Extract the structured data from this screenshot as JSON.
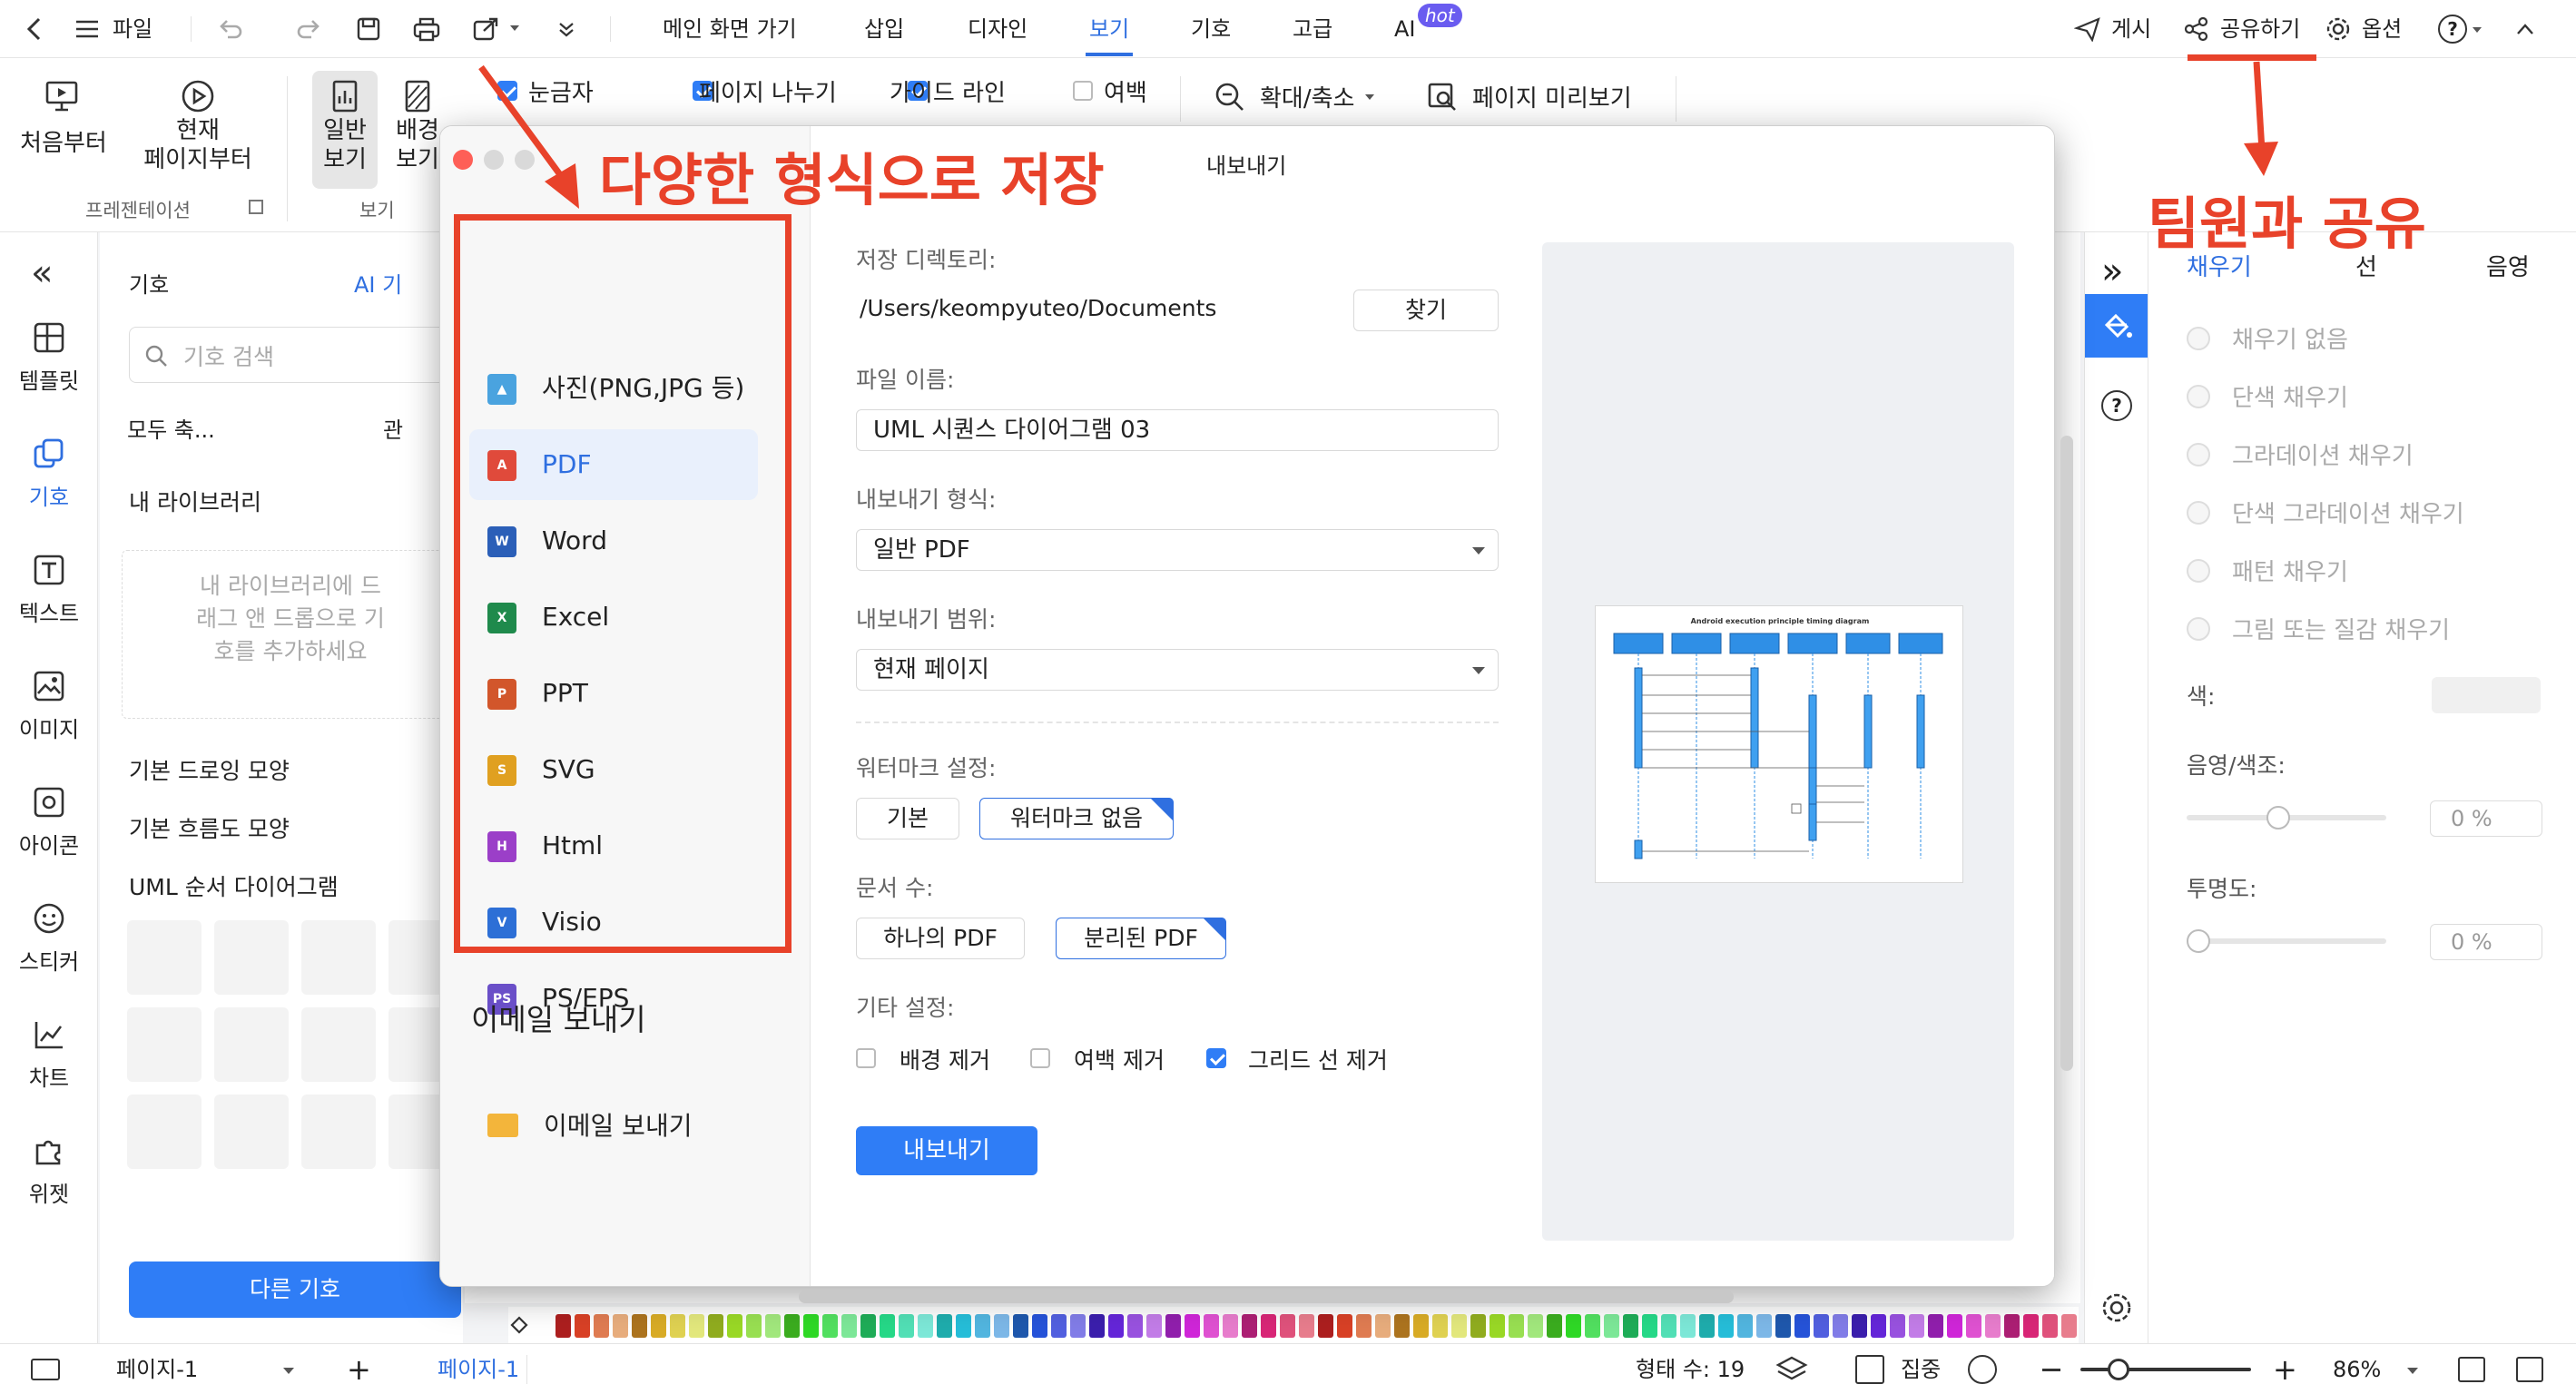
{
  "topbar": {
    "back": "<",
    "menu_label": "파일",
    "tabs": [
      "메인 화면 가기",
      "삽입",
      "디자인",
      "보기",
      "기호",
      "고급"
    ],
    "active_tab": "보기",
    "ai_label": "AI",
    "ai_badge": "hot",
    "publish": "게시",
    "share": "공유하기",
    "options": "옵션",
    "help": "?",
    "collapse": "^"
  },
  "ribbon": {
    "present_from_start": "처음부터",
    "present_from_current_1": "현재",
    "present_from_current_2": "페이지부터",
    "group_presentation": "프레젠테이션",
    "normal_view_1": "일반",
    "normal_view_2": "보기",
    "bg_view_1": "배경",
    "bg_view_2": "보기",
    "group_view": "보기",
    "ruler": "눈금자",
    "page_break": "페이지 나누기",
    "guide_line": "가이드 라인",
    "margin": "여백",
    "zoom": "확대/축소",
    "print_preview": "페이지 미리보기"
  },
  "rail": {
    "collapse": "«",
    "items": [
      "템플릿",
      "기호",
      "텍스트",
      "이미지",
      "아이콘",
      "스티커",
      "차트",
      "위젯"
    ]
  },
  "symbols": {
    "title": "기호",
    "ai_label": "AI 기",
    "search_placeholder": "기호 검색",
    "collapse_all": "모두 축...",
    "manage": "관",
    "my_library": "내 라이브러리",
    "drop_hint": "내 라이브러리에 드래그 앤 드롭으로 기호를 추가하세요",
    "basic_drawing": "기본 드로잉 모양",
    "basic_flow": "기본 흐름도 모양",
    "uml_seq": "UML 순서 다이어그램",
    "more_button": "다른 기호"
  },
  "right": {
    "expand": "»",
    "tabs": [
      "채우기",
      "선",
      "음영"
    ],
    "fill_options": [
      "채우기 없음",
      "단색 채우기",
      "그라데이션 채우기",
      "단색 그라데이션 채우기",
      "패턴 채우기",
      "그림 또는 질감 채우기"
    ],
    "color_label": "색:",
    "shade_label": "음영/색조:",
    "shade_value": "0 %",
    "transparency_label": "투명도:",
    "transparency_value": "0 %"
  },
  "dialog": {
    "title": "내보내기",
    "formats": [
      "사진(PNG,JPG 등)",
      "PDF",
      "Word",
      "Excel",
      "PPT",
      "SVG",
      "Html",
      "Visio",
      "PS/EPS"
    ],
    "selected_format": "PDF",
    "format_icons": [
      "image-icon",
      "pdf-icon",
      "word-icon",
      "excel-icon",
      "ppt-icon",
      "svg-icon",
      "html-icon",
      "visio-icon",
      "eps-icon"
    ],
    "format_icon_letters": [
      "▲",
      "A",
      "W",
      "X",
      "P",
      "S",
      "H",
      "V",
      "PS"
    ],
    "format_colors": [
      "#4aa3df",
      "#e04a3b",
      "#2b5fb8",
      "#1f8a4c",
      "#d2562b",
      "#e0a020",
      "#9b3fc8",
      "#2d6fd6",
      "#6a4fc8"
    ],
    "email_heading": "이메일 보내기",
    "email_item": "이메일 보내기",
    "dir_label": "저장 디렉토리:",
    "dir_value": "/Users/keompyuteo/Documents",
    "browse": "찾기",
    "filename_label": "파일 이름:",
    "filename_value": "UML 시퀀스 다이어그램 03",
    "format_label": "내보내기 형식:",
    "format_value": "일반 PDF",
    "range_label": "내보내기 범위:",
    "range_value": "현재 페이지",
    "watermark_label": "워터마크 설정:",
    "wm_basic": "기본",
    "wm_none": "워터마크 없음",
    "doc_count_label": "문서 수:",
    "doc_single": "하나의 PDF",
    "doc_separate": "분리된 PDF",
    "other_label": "기타 설정:",
    "opt_bg": "배경 제거",
    "opt_margin": "여백 제거",
    "opt_grid": "그리드 선 제거",
    "export_button": "내보내기",
    "preview_title": "Android execution principle timing diagram"
  },
  "annotations": {
    "save_formats": "다양한 형식으로 저장",
    "team_share": "팀원과 공유"
  },
  "status": {
    "page_select": "페이지-1",
    "add": "+",
    "page_tab": "페이지-1",
    "shape_count": "형태 수: 19",
    "focus": "집중",
    "zoom": "86%"
  },
  "colors": {
    "accent": "#2f7df6",
    "annotation": "#e8422a"
  }
}
